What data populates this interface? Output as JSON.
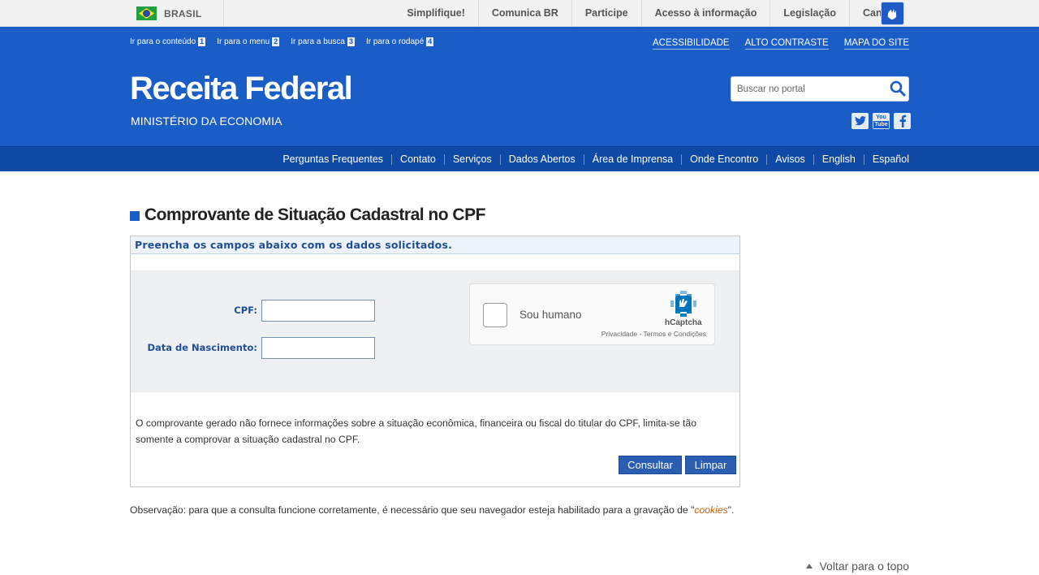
{
  "govbar": {
    "brasil_label": "BRASIL",
    "links": [
      "Simplifique!",
      "Comunica BR",
      "Participe",
      "Acesso à informação",
      "Legislação",
      "Canais"
    ]
  },
  "header": {
    "access_links": [
      {
        "label": "Ir para o conteúdo",
        "num": "1"
      },
      {
        "label": "Ir para o menu",
        "num": "2"
      },
      {
        "label": "Ir para a busca",
        "num": "3"
      },
      {
        "label": "Ir para o rodapé",
        "num": "4"
      }
    ],
    "top_links": [
      "ACESSIBILIDADE",
      "ALTO CONTRASTE",
      "MAPA DO SITE"
    ],
    "title": "Receita Federal",
    "subtitle": "MINISTÉRIO DA ECONOMIA",
    "search_placeholder": "Buscar no portal",
    "social": [
      "twitter-icon",
      "youtube-icon",
      "facebook-icon"
    ]
  },
  "nav": {
    "items": [
      "Perguntas Frequentes",
      "Contato",
      "Serviços",
      "Dados Abertos",
      "Área de Imprensa",
      "Onde Encontro",
      "Avisos",
      "English",
      "Español"
    ]
  },
  "main": {
    "title": "Comprovante de Situação Cadastral no CPF",
    "form_header": "Preencha os campos abaixo com os dados solicitados.",
    "cpf_label": "CPF:",
    "cpf_value": "",
    "birth_label": "Data de Nascimento:",
    "birth_value": "",
    "captcha": {
      "text": "Sou humano",
      "brand": "hCaptcha",
      "links": "Privacidade - Termos e Condições"
    },
    "disclaimer": "O comprovante gerado não fornece informações sobre a situação econômica, financeira ou fiscal do titular do CPF, limita-se tão somente a comprovar a situação cadastral no CPF.",
    "consultar_label": "Consultar",
    "limpar_label": "Limpar",
    "obs_prefix": " Observação: para que a consulta funcione corretamente, é necessário que seu navegador esteja habilitado para a gravação de \"",
    "obs_cookies": "cookies",
    "obs_suffix": "\".",
    "back_to_top": "Voltar para o topo"
  },
  "colors": {
    "header_blue": "#1b5dc7",
    "nav_blue": "#0e49a6",
    "button_blue": "#2b5db1",
    "label_blue": "#1f4e96",
    "cookies_orange": "#c9610f"
  }
}
